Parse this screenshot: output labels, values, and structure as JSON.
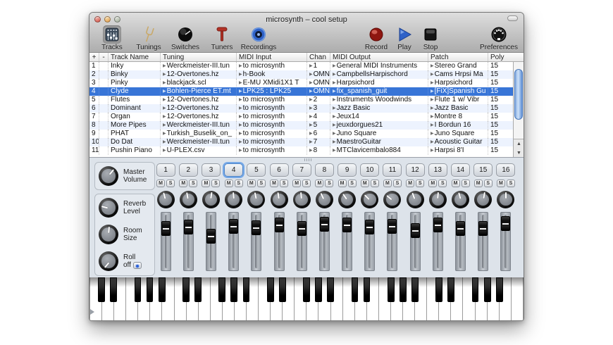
{
  "window": {
    "title": "microsynth – cool setup"
  },
  "colors": {
    "selection": "#3875d7",
    "row_stripe": "#edf3fe",
    "record_red": "#b4241c",
    "play_blue": "#2f62c8",
    "mixer_bg": "#dde3ea"
  },
  "toolbar": {
    "items": [
      {
        "label": "Tracks",
        "icon": "tracks-mixer-icon",
        "selected": true
      },
      {
        "label": "Tunings",
        "icon": "tuning-fork-icon",
        "selected": false
      },
      {
        "label": "Switches",
        "icon": "knob-icon",
        "selected": false
      },
      {
        "label": "Tuners",
        "icon": "tuner-icon",
        "selected": false
      },
      {
        "label": "Recordings",
        "icon": "speaker-icon",
        "selected": false
      }
    ],
    "transport": [
      {
        "label": "Record",
        "icon": "record-icon"
      },
      {
        "label": "Play",
        "icon": "play-icon"
      },
      {
        "label": "Stop",
        "icon": "stop-icon"
      }
    ],
    "preferences": {
      "label": "Preferences",
      "icon": "midi-din-icon"
    }
  },
  "table": {
    "headers": [
      "+",
      "-",
      "Track Name",
      "Tuning",
      "MIDI Input",
      "Chan",
      "MIDI Output",
      "Patch",
      "Poly"
    ],
    "rows": [
      {
        "num": "1",
        "name": "Inky",
        "tuning": "Werckmeister-III.tun",
        "midi_input": "to microsynth",
        "chan": "1",
        "midi_output": "General MIDI Instruments",
        "patch": "Stereo Grand",
        "poly": "15",
        "selected": false
      },
      {
        "num": "2",
        "name": "Binky",
        "tuning": "12-Overtones.hz",
        "midi_input": "h-Book",
        "chan": "OMNI",
        "midi_output": "CampbellsHarpischord",
        "patch": "Cams Hrpsi Ma",
        "poly": "15",
        "selected": false
      },
      {
        "num": "3",
        "name": "Pinky",
        "tuning": "blackjack.scl",
        "midi_input": "E-MU XMidi1X1 T",
        "chan": "OMNI",
        "midi_output": "Harpsichord",
        "patch": "Harpsichord",
        "poly": "15",
        "selected": false
      },
      {
        "num": "4",
        "name": "Clyde",
        "tuning": "Bohlen-Pierce ET.mt",
        "midi_input": "LPK25 : LPK25",
        "chan": "OMNI",
        "midi_output": "fix_spanish_guit",
        "patch": "[FiX]Spanish Gu",
        "poly": "15",
        "selected": true
      },
      {
        "num": "5",
        "name": "Flutes",
        "tuning": "12-Overtones.hz",
        "midi_input": "to microsynth",
        "chan": "2",
        "midi_output": "Instruments Woodwinds",
        "patch": "Flute 1 w/ Vibr",
        "poly": "15",
        "selected": false
      },
      {
        "num": "6",
        "name": "Dominant",
        "tuning": "12-Overtones.hz",
        "midi_input": "to microsynth",
        "chan": "3",
        "midi_output": "Jazz Basic",
        "patch": "Jazz Basic",
        "poly": "15",
        "selected": false
      },
      {
        "num": "7",
        "name": "Organ",
        "tuning": "12-Overtones.hz",
        "midi_input": "to microsynth",
        "chan": "4",
        "midi_output": "Jeux14",
        "patch": "Montre 8",
        "poly": "15",
        "selected": false
      },
      {
        "num": "8",
        "name": "More Pipes",
        "tuning": "Werckmeister-III.tun",
        "midi_input": "to microsynth",
        "chan": "5",
        "midi_output": "jeuxdorgues21",
        "patch": "I Bordun 16",
        "poly": "15",
        "selected": false
      },
      {
        "num": "9",
        "name": "PHAT",
        "tuning": "Turkish_Buselik_on_",
        "midi_input": "to microsynth",
        "chan": "6",
        "midi_output": "Juno Square",
        "patch": "Juno Square",
        "poly": "15",
        "selected": false
      },
      {
        "num": "10",
        "name": "Do Dat",
        "tuning": "Werckmeister-III.tun",
        "midi_input": "to microsynth",
        "chan": "7",
        "midi_output": "MaestroGuitar",
        "patch": "Acoustic Guitar",
        "poly": "15",
        "selected": false
      },
      {
        "num": "11",
        "name": "Pushin Piano",
        "tuning": "U-PLEX.csv",
        "midi_input": "to microsynth",
        "chan": "8",
        "midi_output": "MTClavicembalo884",
        "patch": "Harpsi 8'I",
        "poly": "15",
        "selected": false
      }
    ]
  },
  "mixer": {
    "master": {
      "line1": "Master",
      "line2": "Volume",
      "angle": 40
    },
    "sends": [
      {
        "line1": "Reverb",
        "line2": "Level",
        "angle": -75,
        "led": false
      },
      {
        "line1": "Room",
        "line2": "Size",
        "angle": 5,
        "led": false
      },
      {
        "line1": "Roll",
        "line2": "off",
        "angle": -140,
        "led": true
      }
    ],
    "mute_label": "M",
    "solo_label": "S",
    "selected_channel": "4",
    "channels": [
      {
        "num": "1",
        "knob_angle": -15,
        "fader_pos": 0.2
      },
      {
        "num": "2",
        "knob_angle": -10,
        "fader_pos": 0.16
      },
      {
        "num": "3",
        "knob_angle": 8,
        "fader_pos": 0.38
      },
      {
        "num": "4",
        "knob_angle": -5,
        "fader_pos": 0.14
      },
      {
        "num": "5",
        "knob_angle": -12,
        "fader_pos": 0.18
      },
      {
        "num": "6",
        "knob_angle": -8,
        "fader_pos": 0.12
      },
      {
        "num": "7",
        "knob_angle": -5,
        "fader_pos": 0.2
      },
      {
        "num": "8",
        "knob_angle": -25,
        "fader_pos": 0.1
      },
      {
        "num": "9",
        "knob_angle": -35,
        "fader_pos": 0.12
      },
      {
        "num": "10",
        "knob_angle": -45,
        "fader_pos": 0.16
      },
      {
        "num": "11",
        "knob_angle": -50,
        "fader_pos": 0.14
      },
      {
        "num": "12",
        "knob_angle": -20,
        "fader_pos": 0.24
      },
      {
        "num": "13",
        "knob_angle": 5,
        "fader_pos": 0.12
      },
      {
        "num": "14",
        "knob_angle": -15,
        "fader_pos": 0.2
      },
      {
        "num": "15",
        "knob_angle": 10,
        "fader_pos": 0.2
      },
      {
        "num": "16",
        "knob_angle": 0,
        "fader_pos": 0.08
      }
    ]
  },
  "keyboard": {
    "white_keys": 36,
    "octaves": 5
  }
}
